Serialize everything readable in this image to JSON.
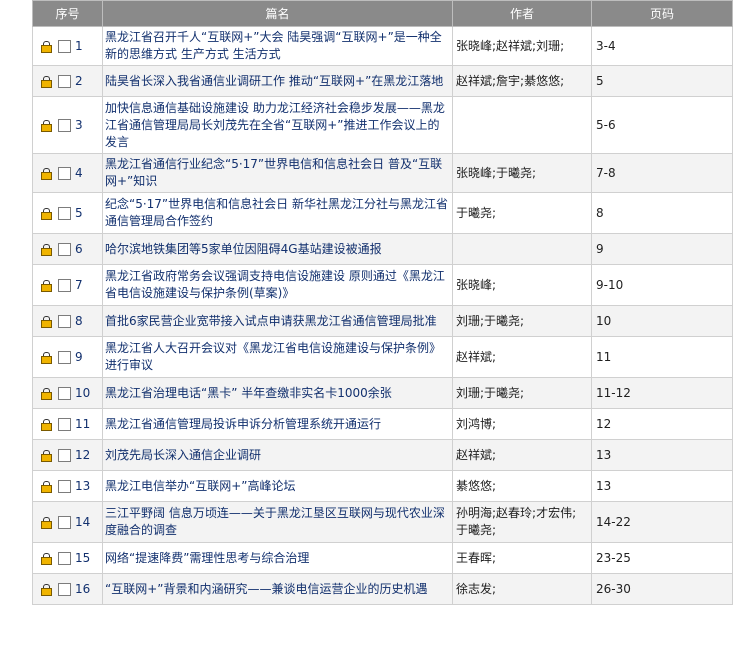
{
  "columns": {
    "seq": "序号",
    "title": "篇名",
    "author": "作者",
    "pages": "页码"
  },
  "rows": [
    {
      "num": "1",
      "title": "黑龙江省召开千人“互联网+”大会 陆昊强调“互联网+”是一种全新的思维方式 生产方式 生活方式",
      "author": "张晓峰;赵祥斌;刘珊;",
      "pages": "3-4"
    },
    {
      "num": "2",
      "title": "陆昊省长深入我省通信业调研工作 推动“互联网+”在黑龙江落地",
      "author": "赵祥斌;詹宇;綦悠悠;",
      "pages": "5"
    },
    {
      "num": "3",
      "title": "加快信息通信基础设施建设 助力龙江经济社会稳步发展——黑龙江省通信管理局局长刘茂先在全省“互联网+”推进工作会议上的发言",
      "author": "",
      "pages": "5-6"
    },
    {
      "num": "4",
      "title": "黑龙江省通信行业纪念“5·17”世界电信和信息社会日 普及“互联网+”知识",
      "author": "张晓峰;于曦尧;",
      "pages": "7-8"
    },
    {
      "num": "5",
      "title": "纪念“5·17”世界电信和信息社会日 新华社黑龙江分社与黑龙江省通信管理局合作签约",
      "author": "于曦尧;",
      "pages": "8"
    },
    {
      "num": "6",
      "title": "哈尔滨地铁集团等5家单位因阻碍4G基站建设被通报",
      "author": "",
      "pages": "9"
    },
    {
      "num": "7",
      "title": "黑龙江省政府常务会议强调支持电信设施建设 原则通过《黑龙江省电信设施建设与保护条例(草案)》",
      "author": "张晓峰;",
      "pages": "9-10"
    },
    {
      "num": "8",
      "title": "首批6家民营企业宽带接入试点申请获黑龙江省通信管理局批准",
      "author": "刘珊;于曦尧;",
      "pages": "10"
    },
    {
      "num": "9",
      "title": "黑龙江省人大召开会议对《黑龙江省电信设施建设与保护条例》进行审议",
      "author": "赵祥斌;",
      "pages": "11"
    },
    {
      "num": "10",
      "title": "黑龙江省治理电话“黑卡” 半年查缴非实名卡1000余张",
      "author": "刘珊;于曦尧;",
      "pages": "11-12"
    },
    {
      "num": "11",
      "title": "黑龙江省通信管理局投诉申诉分析管理系统开通运行",
      "author": "刘鸿博;",
      "pages": "12"
    },
    {
      "num": "12",
      "title": "刘茂先局长深入通信企业调研",
      "author": "赵祥斌;",
      "pages": "13"
    },
    {
      "num": "13",
      "title": "黑龙江电信举办“互联网+”高峰论坛",
      "author": "綦悠悠;",
      "pages": "13"
    },
    {
      "num": "14",
      "title": "三江平野阔 信息万顷连——关于黑龙江垦区互联网与现代农业深度融合的调查",
      "author": "孙明海;赵春玲;才宏伟;于曦尧;",
      "pages": "14-22"
    },
    {
      "num": "15",
      "title": "网络“提速降费”需理性思考与综合治理",
      "author": "王春晖;",
      "pages": "23-25"
    },
    {
      "num": "16",
      "title": "“互联网+”背景和内涵研究——兼谈电信运营企业的历史机遇",
      "author": "徐志发;",
      "pages": "26-30"
    }
  ]
}
